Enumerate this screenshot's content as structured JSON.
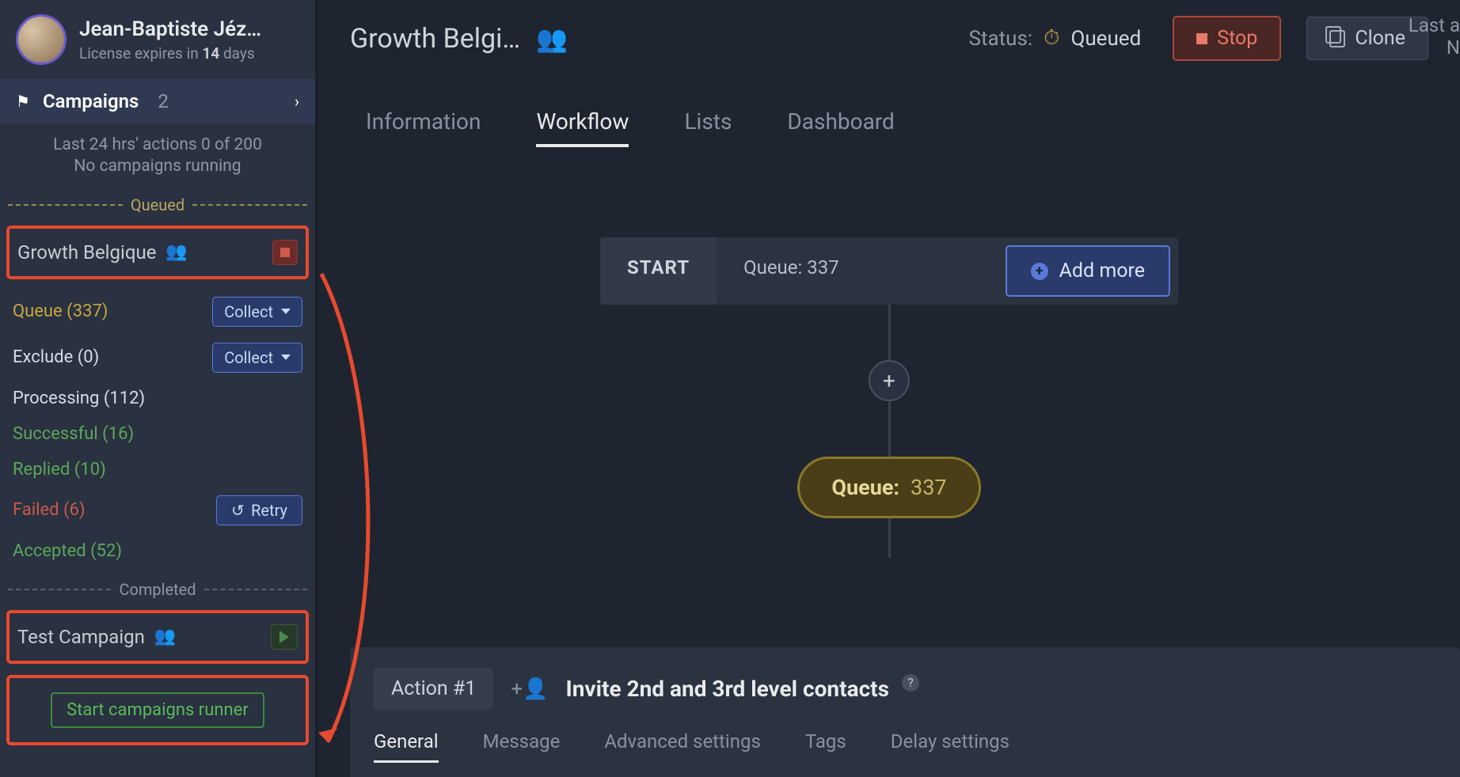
{
  "user": {
    "name": "Jean-Baptiste Jéz…",
    "license_prefix": "License expires in ",
    "license_days": "14",
    "license_suffix": " days"
  },
  "sidebar": {
    "campaigns_label": "Campaigns",
    "campaigns_count": "2",
    "stats_line1": "Last 24 hrs' actions 0 of 200",
    "stats_line2": "No campaigns running",
    "queued_divider": "Queued",
    "completed_divider": "Completed",
    "campaign1": {
      "name": "Growth Belgique"
    },
    "campaign2": {
      "name": "Test Campaign"
    },
    "stats": {
      "queue": "Queue (337)",
      "exclude": "Exclude (0)",
      "processing": "Processing (112)",
      "successful": "Successful (16)",
      "replied": "Replied (10)",
      "failed": "Failed (6)",
      "accepted": "Accepted (52)"
    },
    "collect_btn": "Collect",
    "retry_btn": "Retry",
    "runner_btn": "Start campaigns runner"
  },
  "header": {
    "title": "Growth Belgi…",
    "status_label": "Status:",
    "status_value": "Queued",
    "stop_btn": "Stop",
    "clone_btn": "Clone",
    "last_label1": "Last a",
    "last_label2": "N"
  },
  "tabs": {
    "information": "Information",
    "workflow": "Workflow",
    "lists": "Lists",
    "dashboard": "Dashboard"
  },
  "workflow": {
    "start_label": "START",
    "queue_label": "Queue: 337",
    "addmore_btn": "Add more",
    "pill_label": "Queue:",
    "pill_value": "337"
  },
  "action": {
    "badge": "Action #1",
    "title": "Invite 2nd and 3rd level contacts",
    "tabs": {
      "general": "General",
      "message": "Message",
      "advanced": "Advanced settings",
      "tags": "Tags",
      "delay": "Delay settings"
    }
  }
}
